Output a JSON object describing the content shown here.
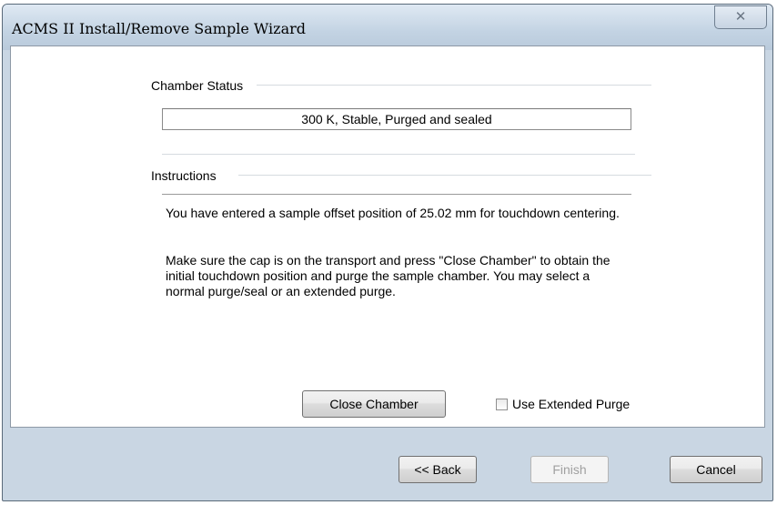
{
  "window": {
    "title": "ACMS II Install/Remove Sample Wizard",
    "close_glyph": "✕"
  },
  "chamber_status": {
    "label": "Chamber Status",
    "value": "300 K, Stable, Purged and sealed"
  },
  "instructions": {
    "label": "Instructions",
    "paragraphs": [
      "You have entered a sample offset position of 25.02 mm for touchdown centering.",
      "Make sure the cap is on the transport and press \"Close Chamber\" to obtain the initial touchdown position and purge the sample chamber. You may select a normal purge/seal or an extended purge."
    ]
  },
  "actions": {
    "close_chamber_label": "Close Chamber",
    "extended_purge_label": "Use Extended Purge",
    "extended_purge_checked": false
  },
  "footer": {
    "back_label": "<< Back",
    "finish_label": "Finish",
    "cancel_label": "Cancel"
  }
}
